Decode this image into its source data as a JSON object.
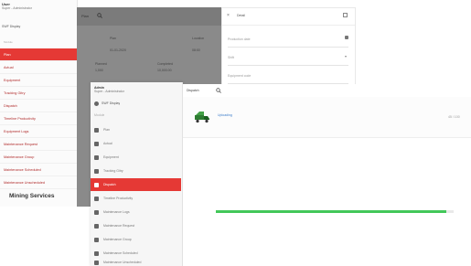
{
  "sidebar_back": {
    "header_title": "User",
    "header_subtitle": "Super - Administrator",
    "selector_value": "SWF Display",
    "section_label": "Module",
    "items": [
      {
        "label": "Plan",
        "active": true
      },
      {
        "label": "Actual",
        "active": false
      },
      {
        "label": "Equipment",
        "active": false
      },
      {
        "label": "Tracking Gitry",
        "active": false
      },
      {
        "label": "Dispatch",
        "active": false
      },
      {
        "label": "Timeline Productivity",
        "active": false
      },
      {
        "label": "Equipment Logs",
        "active": false
      },
      {
        "label": "Maintenance Request",
        "active": false
      },
      {
        "label": "Maintenance Group",
        "active": false
      },
      {
        "label": "Maintenance Scheduled",
        "active": false
      },
      {
        "label": "Maintenance Unscheduled",
        "active": false
      }
    ],
    "brand": "Mining Services"
  },
  "overlay_panel": {
    "title": "Plan",
    "row1": [
      "Plan",
      "Location"
    ],
    "row2": [
      "01-01-2020",
      "08:00"
    ],
    "row3": [
      "Planned",
      "Completed"
    ],
    "row4": [
      "1,000",
      "10,000.00"
    ]
  },
  "right_panel": {
    "title": "Detail",
    "fields": [
      "Production date",
      "Shift",
      "Equipment code"
    ]
  },
  "sidebar_front": {
    "header_title": "Admin",
    "header_subtitle": "Super - Administrator",
    "selector_value": "SWF Display",
    "section_label": "Module",
    "items": [
      {
        "label": "Plan",
        "active": false
      },
      {
        "label": "Actual",
        "active": false
      },
      {
        "label": "Equipment",
        "active": false
      },
      {
        "label": "Tracking Gitry",
        "active": false
      },
      {
        "label": "Dispatch",
        "active": true
      },
      {
        "label": "Timeline Productivity",
        "active": false
      },
      {
        "label": "Maintenance Logs",
        "active": false
      },
      {
        "label": "Maintenance Request",
        "active": false
      },
      {
        "label": "Maintenance Group",
        "active": false
      },
      {
        "label": "Maintenance Scheduled",
        "active": false
      },
      {
        "label": "Maintenance Unscheduled",
        "active": false
      }
    ]
  },
  "content_panel": {
    "title": "Dispatch",
    "card_label": "Uploading",
    "card_value": "45 / 100",
    "progress": 0.97
  },
  "colors": {
    "accent": "#e53935",
    "progress": "#43c85a",
    "overlay": "#8a8a8a"
  }
}
